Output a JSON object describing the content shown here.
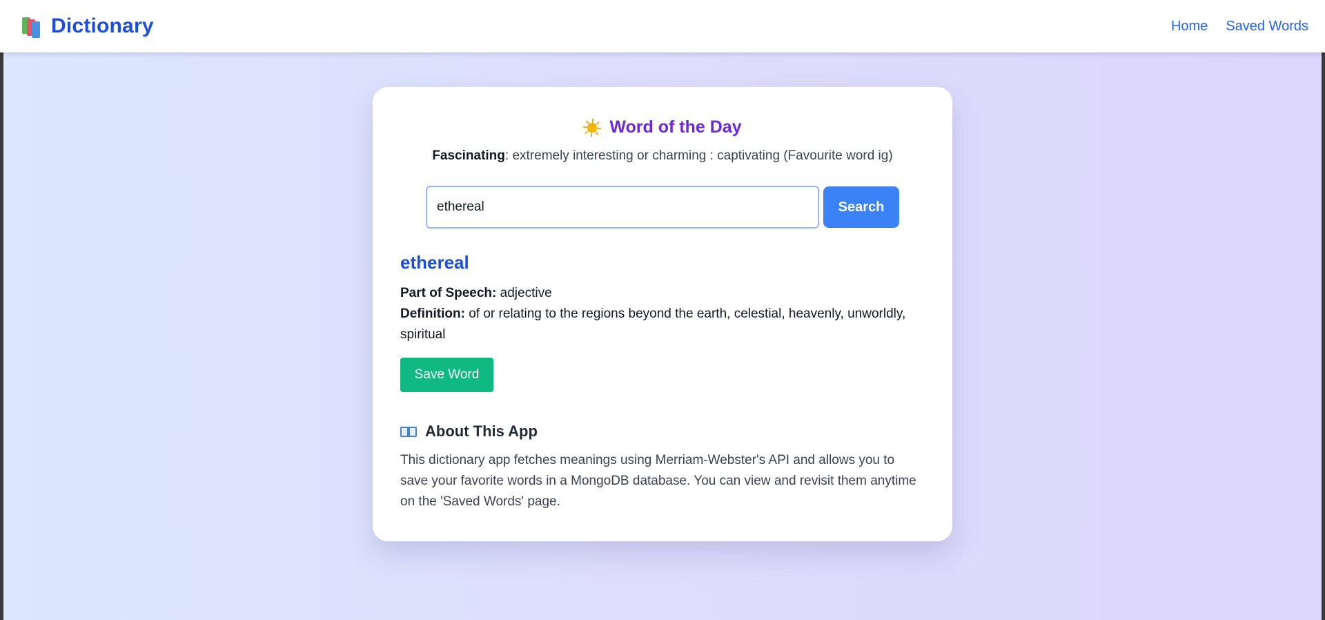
{
  "navbar": {
    "brand_icon": "books-icon",
    "brand_title": "Dictionary",
    "links": [
      {
        "label": "Home"
      },
      {
        "label": "Saved Words"
      }
    ]
  },
  "word_of_day": {
    "icon": "sun-icon",
    "title": "Word of the Day",
    "word": "Fascinating",
    "definition": ": extremely interesting or charming : captivating (Favourite word ig)"
  },
  "search": {
    "value": "ethereal",
    "button_label": "Search"
  },
  "result": {
    "word": "ethereal",
    "pos_label": "Part of Speech:",
    "pos_value": "adjective",
    "definition_label": "Definition:",
    "definition_value": "of or relating to the regions beyond the earth, celestial, heavenly, unworldly, spiritual",
    "save_label": "Save Word"
  },
  "about": {
    "icon": "open-book-icon",
    "title": "About This App",
    "text": "This dictionary app fetches meanings using Merriam-Webster's API and allows you to save your favorite words in a MongoDB database. You can view and revisit them anytime on the 'Saved Words' page."
  },
  "colors": {
    "brand": "#1d4ed8",
    "accent_purple": "#6d28d9",
    "search_button": "#3b82f6",
    "save_button": "#10b981"
  }
}
